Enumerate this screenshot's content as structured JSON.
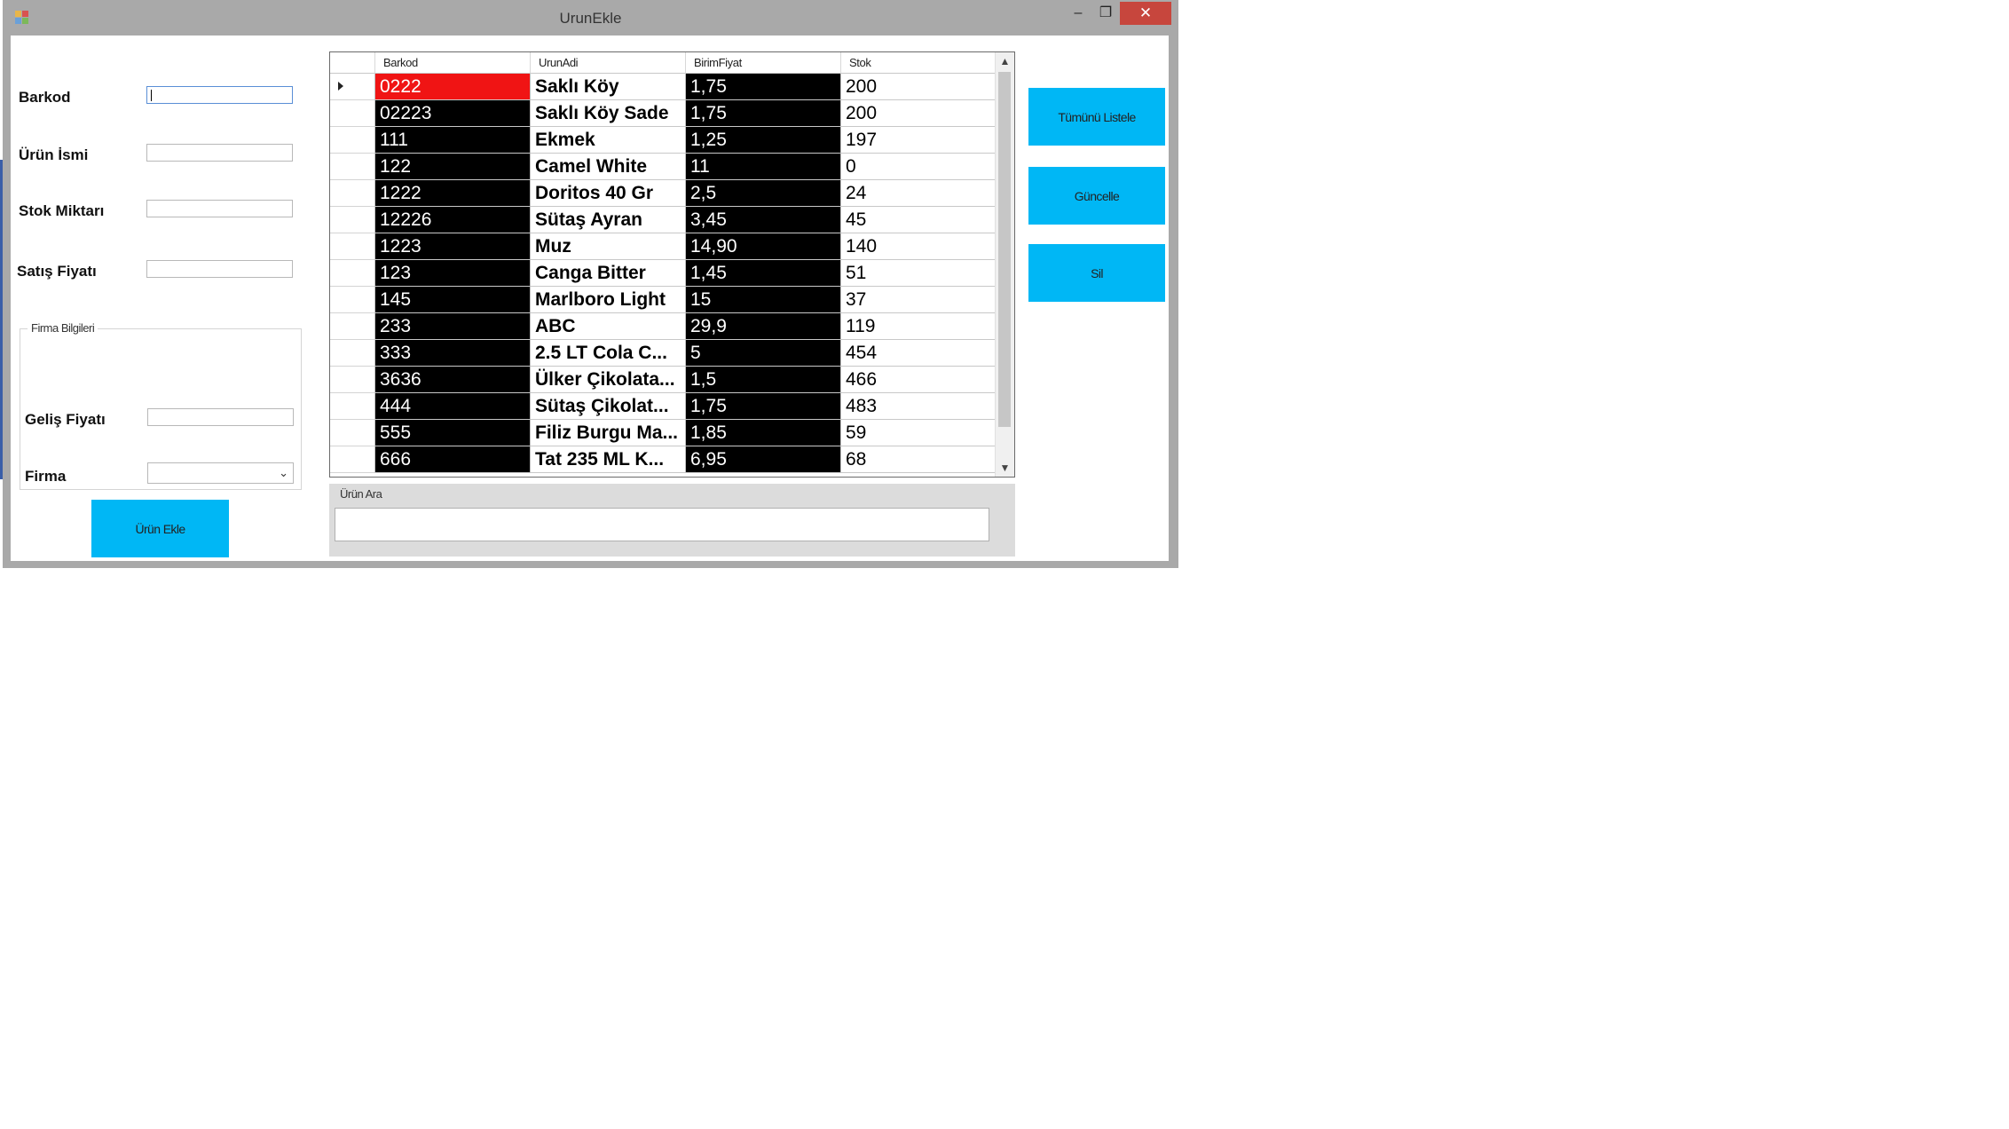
{
  "window": {
    "title": "UrunEkle",
    "minimize": "–",
    "maximize": "❐",
    "close": "✕"
  },
  "form": {
    "barkod_label": "Barkod",
    "barkod_value": "",
    "urun_ismi_label": "Ürün İsmi",
    "urun_ismi_value": "",
    "stok_miktari_label": "Stok Miktarı",
    "stok_miktari_value": "",
    "satis_fiyati_label": "Satış Fiyatı",
    "satis_fiyati_value": ""
  },
  "firma_group": {
    "caption": "Firma Bilgileri",
    "gelis_fiyati_label": "Geliş Fiyatı",
    "gelis_fiyati_value": "",
    "firma_label": "Firma",
    "firma_selected": ""
  },
  "buttons": {
    "urun_ekle": "Ürün Ekle",
    "tumunu_listele": "Tümünü Listele",
    "guncelle": "Güncelle",
    "sil": "Sil"
  },
  "grid": {
    "columns": [
      "Barkod",
      "UrunAdi",
      "BirimFiyat",
      "Stok"
    ],
    "rows": [
      {
        "barkod": "0222",
        "urun_adi": "Saklı Köy",
        "birim_fiyat": "1,75",
        "stok": "200"
      },
      {
        "barkod": "02223",
        "urun_adi": "Saklı Köy Sade",
        "birim_fiyat": "1,75",
        "stok": "200"
      },
      {
        "barkod": "111",
        "urun_adi": "Ekmek",
        "birim_fiyat": "1,25",
        "stok": "197"
      },
      {
        "barkod": "122",
        "urun_adi": "Camel White",
        "birim_fiyat": "11",
        "stok": "0"
      },
      {
        "barkod": "1222",
        "urun_adi": "Doritos 40 Gr",
        "birim_fiyat": "2,5",
        "stok": "24"
      },
      {
        "barkod": "12226",
        "urun_adi": "Sütaş Ayran",
        "birim_fiyat": "3,45",
        "stok": "45"
      },
      {
        "barkod": "1223",
        "urun_adi": "Muz",
        "birim_fiyat": "14,90",
        "stok": "140"
      },
      {
        "barkod": "123",
        "urun_adi": "Canga Bitter",
        "birim_fiyat": "1,45",
        "stok": "51"
      },
      {
        "barkod": "145",
        "urun_adi": "Marlboro Light",
        "birim_fiyat": "15",
        "stok": "37"
      },
      {
        "barkod": "233",
        "urun_adi": "ABC",
        "birim_fiyat": "29,9",
        "stok": "119"
      },
      {
        "barkod": "333",
        "urun_adi": "2.5 LT Cola C...",
        "birim_fiyat": "5",
        "stok": "454"
      },
      {
        "barkod": "3636",
        "urun_adi": "Ülker Çikolata...",
        "birim_fiyat": "1,5",
        "stok": "466"
      },
      {
        "barkod": "444",
        "urun_adi": "Sütaş Çikolat...",
        "birim_fiyat": "1,75",
        "stok": "483"
      },
      {
        "barkod": "555",
        "urun_adi": "Filiz Burgu Ma...",
        "birim_fiyat": "1,85",
        "stok": "59"
      },
      {
        "barkod": "666",
        "urun_adi": "Tat 235 ML K...",
        "birim_fiyat": "6,95",
        "stok": "68"
      }
    ]
  },
  "search": {
    "caption": "Ürün Ara",
    "value": ""
  },
  "colors": {
    "button": "#00b7f5",
    "selected_cell": "#f01414",
    "dark_cell": "#000000",
    "close_button": "#c7463d"
  }
}
